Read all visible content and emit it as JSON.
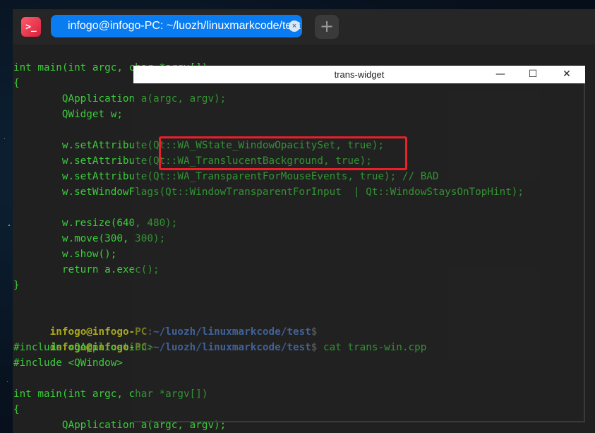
{
  "terminal": {
    "tab_title": "infogo@infogo-PC: ~/luozh/linuxmarkcode/test",
    "app_icon_glyph": ">_",
    "close_glyph": "×",
    "add_glyph": "+",
    "lines": [
      "int main(int argc, char *argv[])",
      "{",
      "        QApplication a(argc, argv);",
      "        QWidget w;",
      "",
      "        w.setAttribute(Qt::WA_WState_WindowOpacitySet, true);",
      "        w.setAttribute(Qt::WA_TranslucentBackground, true);",
      "        w.setAttribute(Qt::WA_TransparentForMouseEvents, true); // BAD",
      "        w.setWindowFlags(Qt::WindowTransparentForInput  | Qt::WindowStaysOnTopHint);",
      "",
      "        w.resize(640, 480);",
      "        w.move(300, 300);",
      "        w.show();",
      "        return a.exec();",
      "}",
      ""
    ],
    "prompt1": {
      "user": "infogo@infogo-PC",
      "sep": ":",
      "path": "~/luozh/linuxmarkcode/test",
      "end": "$",
      "cmd": ""
    },
    "prompt2": {
      "user": "infogo@infogo-PC",
      "sep": ":",
      "path": "~/luozh/linuxmarkcode/test",
      "end": "$",
      "cmd": " cat trans-win.cpp"
    },
    "lines_after": [
      "#include <QApplication>",
      "#include <QWindow>",
      "",
      "int main(int argc, char *argv[])",
      "{",
      "        QApplication a(argc, argv);"
    ]
  },
  "trans_widget": {
    "title": "trans-widget",
    "minimize_glyph": "—",
    "maximize_glyph": "☐",
    "close_glyph": "✕"
  },
  "colors": {
    "code_green": "#3bcc3b",
    "prompt_user": "#a8a81f",
    "prompt_path": "#4f82d6",
    "tab_accent": "#0a7cf1",
    "highlight": "#e8202a"
  }
}
